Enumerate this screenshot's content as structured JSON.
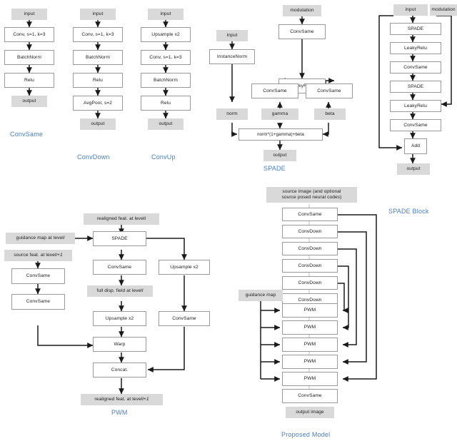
{
  "figure": {
    "kind": "neural-network-architecture-diagram",
    "panels": [
      "ConvSame",
      "ConvDown",
      "ConvUp",
      "SPADE",
      "SPADE Block",
      "PWM",
      "Proposed Model"
    ],
    "colors": {
      "caption": "#4a7ebc",
      "io_fill": "#d9d9d9",
      "proc_fill": "#ffffff",
      "proc_border": "#9a9a9a",
      "wire": "#1a1a1a"
    }
  },
  "labels": {
    "input": "input",
    "output": "output",
    "modulation": "modulation",
    "conv_s1_k3": "Conv, s=1, k=3",
    "batchnorm": "BatchNorm",
    "relu": "Relu",
    "avgpool_s2": "AvgPool, s=2",
    "upsample_x2": "Upsample x2",
    "instancenorm": "InstanceNorm",
    "convsame": "ConvSame",
    "convdown": "ConvDown",
    "leakyrelu": "LeakyRelu",
    "norm": "norm",
    "gamma": "gamma",
    "beta": "beta",
    "spade_formula": "norm*(1+gamma)+beta",
    "spade": "SPADE",
    "add": "Add",
    "warp": "Warp",
    "concat": "Concat.",
    "pwm": "PWM",
    "guidance_map": "guidance map",
    "output_image": "output image"
  },
  "captions": {
    "convsame": "ConvSame",
    "convdown": "ConvDown",
    "convup": "ConvUp",
    "spade": "SPADE",
    "spade_block": "SPADE Block",
    "pwm": "PWM",
    "proposed_model": "Proposed Model"
  },
  "panel_convsame": {
    "caption": "ConvSame",
    "nodes": [
      "input",
      "Conv, s=1, k=3",
      "BatchNorm",
      "Relu",
      "output"
    ]
  },
  "panel_convdown": {
    "caption": "ConvDown",
    "nodes": [
      "input",
      "Conv, s=1, k=3",
      "BatchNorm",
      "Relu",
      "AvgPool, s=2",
      "output"
    ]
  },
  "panel_convup": {
    "caption": "ConvUp",
    "nodes": [
      "input",
      "Upsample x2",
      "Conv, s=1, k=3",
      "BatchNorm",
      "Relu",
      "output"
    ]
  },
  "panel_spade": {
    "caption": "SPADE",
    "inputs": [
      "input",
      "modulation"
    ],
    "left_chain": [
      "InstanceNorm",
      "norm"
    ],
    "mod_chain": [
      "ConvSame",
      "LeakyRelu"
    ],
    "gamma_chain": [
      "ConvSame",
      "gamma"
    ],
    "beta_chain": [
      "ConvSame",
      "beta"
    ],
    "combine": "norm*(1+gamma)+beta",
    "output": "output"
  },
  "panel_spade_block": {
    "caption": "SPADE Block",
    "inputs": [
      "input",
      "modulation"
    ],
    "chain": [
      "SPADE",
      "LeakyRelu",
      "ConvSame",
      "SPADE",
      "LeakyRelu",
      "ConvSame",
      "Add"
    ],
    "output": "output",
    "skip": "input -> Add",
    "modulation_targets": [
      "SPADE (1st)",
      "SPADE (2nd)"
    ]
  },
  "panel_pwm": {
    "caption": "PWM",
    "top_input": "realigned feat. at level l",
    "top_input_plain": "realigned feat. at level ",
    "top_input_ital": "l",
    "guidance_input_plain": "guidance map at level ",
    "guidance_input_ital": "l",
    "source_input_plain": "source feat. at level ",
    "source_input_ital": "l+1",
    "center_chain": [
      "SPADE",
      "ConvSame",
      "full disp. field at level l",
      "Upsample x2",
      "Warp",
      "Concat."
    ],
    "disp_field_plain": "full disp. field at level ",
    "disp_field_ital": "l",
    "right_chain": [
      "Upsample x2",
      "ConvSame"
    ],
    "left_chain": [
      "ConvSame",
      "ConvSame"
    ],
    "bottom_output_plain": "realigned feat. at level ",
    "bottom_output_ital": "l+1"
  },
  "panel_proposed": {
    "caption": "Proposed Model",
    "source_input_line1": "source image (and optional",
    "source_input_line2": "source posed neural codes)",
    "guidance_map": "guidance map",
    "stack": [
      "ConvSame",
      "ConvDown",
      "ConvDown",
      "ConvDown",
      "ConvDown",
      "ConvDown",
      "PWM",
      "PWM",
      "PWM",
      "PWM",
      "PWM",
      "ConvSame"
    ],
    "output": "output image",
    "skips": [
      "ConvSame -> PWM 5",
      "ConvDown 1 -> PWM 4",
      "ConvDown 2 -> PWM 3",
      "ConvDown 3 -> PWM 2",
      "ConvDown 4 -> PWM 1"
    ],
    "guidance_targets": [
      "PWM 1",
      "PWM 2",
      "PWM 3",
      "PWM 4",
      "PWM 5"
    ]
  }
}
